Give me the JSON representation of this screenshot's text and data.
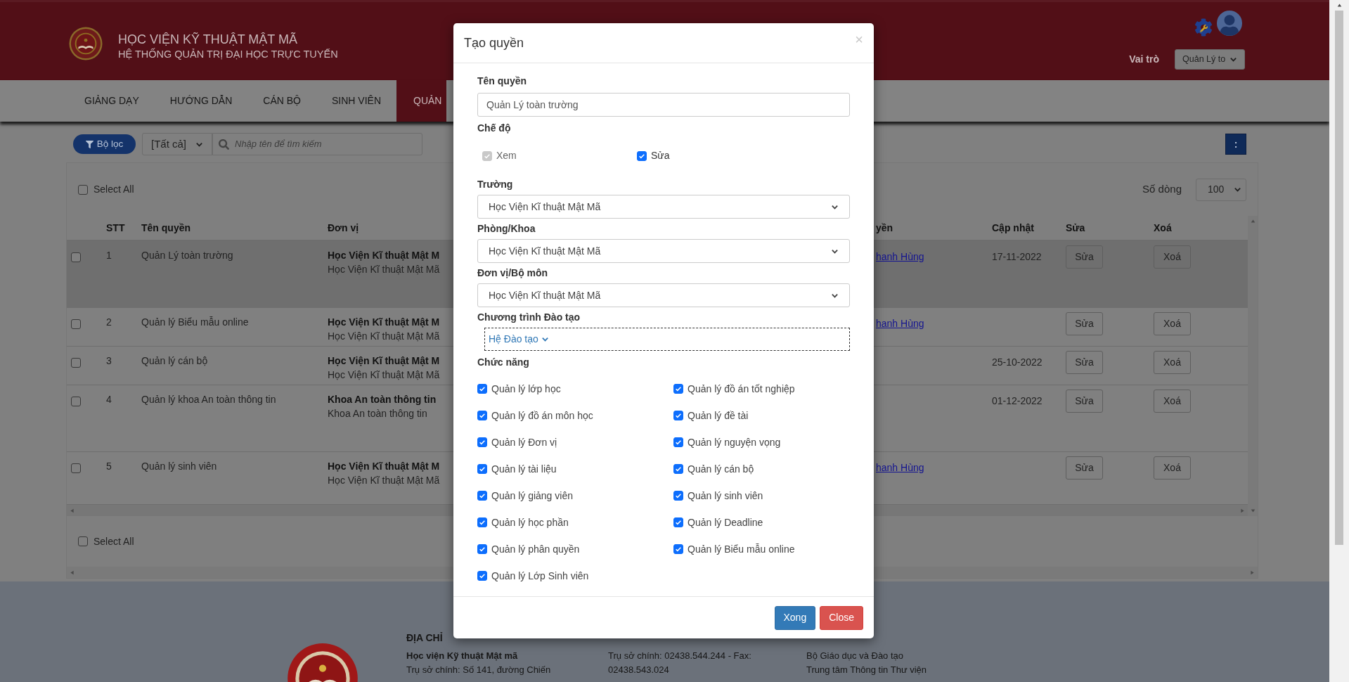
{
  "header": {
    "title": "HỌC VIỆN KỸ THUẬT MẬT MÃ",
    "subtitle": "HỆ THỐNG QUẢN TRỊ ĐẠI HỌC TRỰC TUYẾN",
    "role_label": "Vai trò",
    "role_value": "Quản Lý to"
  },
  "nav": [
    {
      "label": "GIẢNG DẠY",
      "selected": false
    },
    {
      "label": "HƯỚNG DẪN",
      "selected": false
    },
    {
      "label": "CÁN BỘ",
      "selected": false
    },
    {
      "label": "SINH VIÊN",
      "selected": false
    },
    {
      "label": "QUẢN",
      "selected": true
    }
  ],
  "toolbar": {
    "filter_button": "Bộ lọc",
    "scope_value": "[Tất cả]",
    "search_placeholder": "Nhập tên để tìm kiếm",
    "more_button": ":"
  },
  "table": {
    "select_all": {
      "label": "Select All",
      "checked": false
    },
    "rows_label": "Số dòng",
    "rows_value": "100",
    "columns": [
      "STT",
      "Tên quyền",
      "Đơn vị",
      "yền",
      "Cập nhật",
      "Sửa",
      "Xoá"
    ],
    "rows": [
      {
        "checked": false,
        "highlighted": true,
        "stt": "1",
        "name": "Quản Lý toàn trường",
        "unit_bold": "Học Viện Kĩ thuật Mật M",
        "unit": "Học Viện Kĩ thuật Mật Mã",
        "column_4": "hanh Hùng",
        "updated": "17-11-2022",
        "edit": "Sửa",
        "delete": "Xoá"
      },
      {
        "checked": false,
        "highlighted": false,
        "stt": "2",
        "name": "Quản lý Biểu mẫu online",
        "unit_bold": "Học Viện Kĩ thuật Mật M",
        "unit": "Học Viện Kĩ thuật Mật Mã",
        "column_4": "hanh Hùng",
        "edit": "Sửa",
        "delete": "Xoá"
      },
      {
        "checked": false,
        "highlighted": false,
        "stt": "3",
        "name": "Quản lý cán bộ",
        "unit_bold": "Học Viện Kĩ thuật Mật M",
        "unit": "Học Viện Kĩ thuật Mật Mã",
        "updated": "25-10-2022",
        "edit": "Sửa",
        "delete": "Xoá"
      },
      {
        "checked": false,
        "highlighted": false,
        "stt": "4",
        "name": "Quản lý khoa An toàn thông tin",
        "unit_bold": "Khoa An toàn thông tin",
        "unit": "Khoa An toàn thông tin",
        "updated": "01-12-2022",
        "edit": "Sửa",
        "delete": "Xoá"
      },
      {
        "checked": false,
        "highlighted": false,
        "stt": "5",
        "name": "Quản lý sinh viên",
        "unit_bold": "Học Viện Kĩ thuật Mật M",
        "unit": "Học Viện Kĩ thuật Mật Mã",
        "column_4": "hanh Hùng",
        "edit": "Sửa",
        "delete": "Xoá"
      }
    ],
    "bottom_select_all": {
      "label": "Select All",
      "checked": false
    }
  },
  "modal": {
    "title": "Tạo quyền",
    "close": "×",
    "name_label": "Tên quyền",
    "name_value": "Quản Lý toàn trường",
    "mode_label": "Chế độ",
    "modes": [
      {
        "label": "Xem",
        "checked": true,
        "disabled": true
      },
      {
        "label": "Sửa",
        "checked": true,
        "disabled": false
      }
    ],
    "selects": [
      {
        "label": "Trường",
        "value": "Học Viện Kĩ thuật Mật Mã"
      },
      {
        "label": "Phòng/Khoa",
        "value": "Học Viện Kĩ thuật Mật Mã"
      },
      {
        "label": "Đơn vị/Bộ môn",
        "value": "Học Viện Kĩ thuật Mật Mã"
      }
    ],
    "program_label": "Chương trình Đào tạo",
    "program_value": "Hệ Đào tạo",
    "functions_label": "Chức năng",
    "functions": [
      {
        "label": "Quản lý lớp học",
        "checked": true
      },
      {
        "label": "Quản lý đồ án tốt nghiệp",
        "checked": true
      },
      {
        "label": "Quản lý đồ án môn học",
        "checked": true
      },
      {
        "label": "Quản lý đề tài",
        "checked": true
      },
      {
        "label": "Quản lý Đơn vị",
        "checked": true
      },
      {
        "label": "Quản lý nguyện vọng",
        "checked": true
      },
      {
        "label": "Quản lý tài liệu",
        "checked": true
      },
      {
        "label": "Quản lý cán bộ",
        "checked": true
      },
      {
        "label": "Quản lý giảng viên",
        "checked": true
      },
      {
        "label": "Quản lý sinh viên",
        "checked": true
      },
      {
        "label": "Quản lý học phần",
        "checked": true
      },
      {
        "label": "Quản lý Deadline",
        "checked": true
      },
      {
        "label": "Quản lý phân quyền",
        "checked": true
      },
      {
        "label": "Quản lý Biểu mẫu online",
        "checked": true
      },
      {
        "label": "Quản lý Lớp Sinh viên",
        "checked": true
      }
    ],
    "buttons": [
      {
        "label": "Xong",
        "kind": "primary"
      },
      {
        "label": "Close",
        "kind": "danger"
      }
    ]
  },
  "footer": {
    "columns": [
      {
        "heading": "ĐỊA CHỈ",
        "lines": [
          "Học viện Kỹ thuật Mật mã",
          "Trụ sở chính: Số 141, đường Chiến"
        ]
      },
      {
        "lines": [
          "Trụ sở chính: 02438.544.244 - Fax:",
          "02438.543.024"
        ]
      },
      {
        "lines": [
          "Bộ Giáo dục và Đào tạo",
          "Trung tâm Thông tin Thư viện"
        ]
      }
    ]
  }
}
